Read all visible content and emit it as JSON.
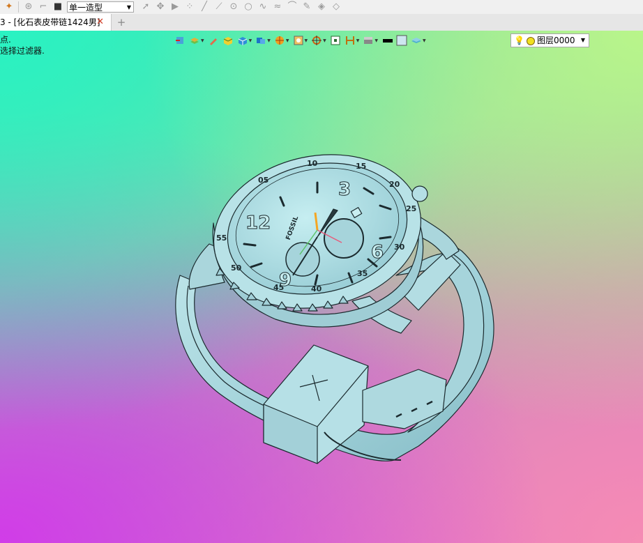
{
  "toolbar": {
    "model_mode": "单一造型",
    "icons": [
      "render-icon",
      "rotate-icon",
      "path-icon",
      "stop-icon",
      "select-icon",
      "tool-icon",
      "play-icon",
      "points-icon",
      "line-icon",
      "line2-icon",
      "circle-dot-icon",
      "circle-icon",
      "curve-icon",
      "wave-icon",
      "arc-icon",
      "pen-icon",
      "layers-icon",
      "layers2-icon"
    ]
  },
  "tab": {
    "title": "3 - [化石表皮带链1424男]",
    "close": "✕",
    "new_tab": "+"
  },
  "prompts": {
    "line1": "点.",
    "line2": "选择过滤器."
  },
  "view_toolbar": {
    "layer_name": "图层0000"
  },
  "model": {
    "bezel_numbers": [
      "10",
      "15",
      "20",
      "25",
      "30",
      "35",
      "40",
      "45",
      "50",
      "55",
      "05"
    ],
    "dial_numerals": [
      "12",
      "3",
      "6",
      "9"
    ],
    "brand": "FOSSIL"
  },
  "colors": {
    "model_fill": "#a9d8de",
    "model_stroke": "#1b2a2e",
    "accent": "#f5a623"
  }
}
